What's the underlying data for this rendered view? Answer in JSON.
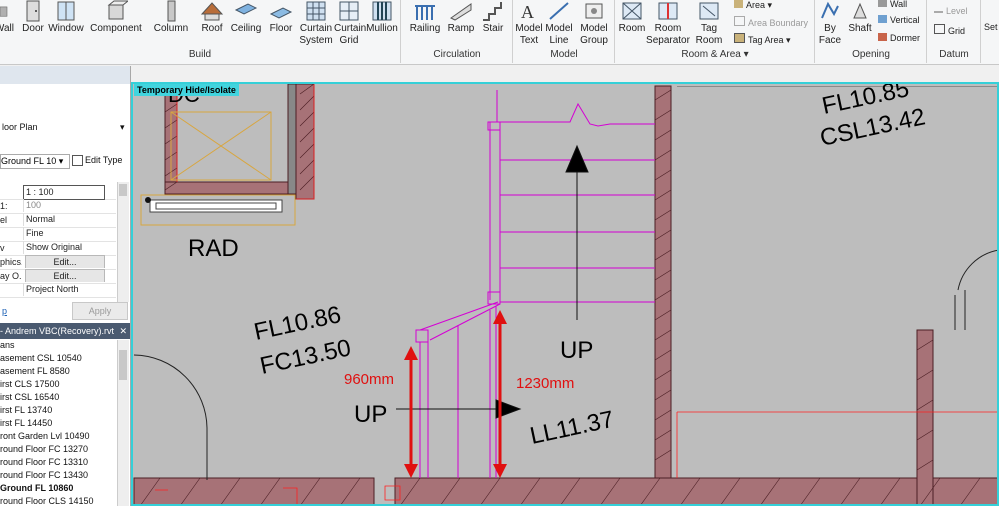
{
  "ribbon": {
    "build_buttons": [
      "Wall",
      "Door",
      "Window",
      "Component",
      "Column",
      "Roof",
      "Ceiling",
      "Floor",
      "Curtain System",
      "Curtain Grid",
      "Mullion"
    ],
    "circulation_buttons": [
      "Railing",
      "Ramp",
      "Stair"
    ],
    "model_buttons": [
      "Model Text",
      "Model Line",
      "Model Group"
    ],
    "room_buttons": [
      "Room",
      "Room Separator",
      "Tag Room"
    ],
    "room_small": [
      "Area",
      "Area  Boundary",
      "Tag  Area"
    ],
    "opening_buttons": [
      "By Face",
      "Shaft"
    ],
    "opening_small": [
      "Wall",
      "Vertical",
      "Dormer"
    ],
    "datum_small": [
      "Level",
      "Grid"
    ],
    "extra_label": "Set",
    "panels": {
      "build": "Build",
      "circulation": "Circulation",
      "model": "Model",
      "room_area": "Room & Area",
      "opening": "Opening",
      "datum": "Datum"
    },
    "dropdown_arrow": "▾"
  },
  "properties": {
    "view_type": "loor Plan",
    "view_select": "Ground FL 10",
    "edit_type": "Edit Type",
    "rows": [
      {
        "label": "",
        "value": "1 : 100"
      },
      {
        "label": "1:",
        "value": "100"
      },
      {
        "label": "el",
        "value": "Normal"
      },
      {
        "label": "",
        "value": "Fine"
      },
      {
        "label": "v",
        "value": "Show Original"
      },
      {
        "label": "phics...",
        "value": "Edit..."
      },
      {
        "label": "ay O...",
        "value": "Edit..."
      },
      {
        "label": "",
        "value": "Project North"
      }
    ],
    "help_text": "p",
    "apply": "Apply"
  },
  "project_browser": {
    "title": "- Andrem VBC(Recovery).rvt",
    "items": [
      "ans",
      "asement CSL 10540",
      "asement FL 8580",
      "irst CLS 17500",
      "irst CSL 16540",
      "irst FL 13740",
      "irst FL 14450",
      "ront Garden Lvl 10490",
      "round Floor FC 13270",
      "round Floor FC 13310",
      "round Floor FC 13430",
      "Ground FL 10860",
      "round Floor CLS 14150"
    ],
    "active_index": 11
  },
  "canvas": {
    "tag": "Temporary Hide/Isolate",
    "labels": {
      "fl1": "FL10.86",
      "fc1": "FC13.50",
      "rad": "RAD",
      "up1": "UP",
      "up2": "UP",
      "ll": "LL11.37",
      "fl2": "FL10.85",
      "csl": "CSL13.42",
      "partial": "DC",
      "dim1": "960mm",
      "dim2": "1230mm"
    },
    "colors": {
      "wall": "#a77277",
      "stair": "#d400d4",
      "dim": "#e01010",
      "bg": "#bdbdbd",
      "highlight": "#35d0d8"
    }
  }
}
